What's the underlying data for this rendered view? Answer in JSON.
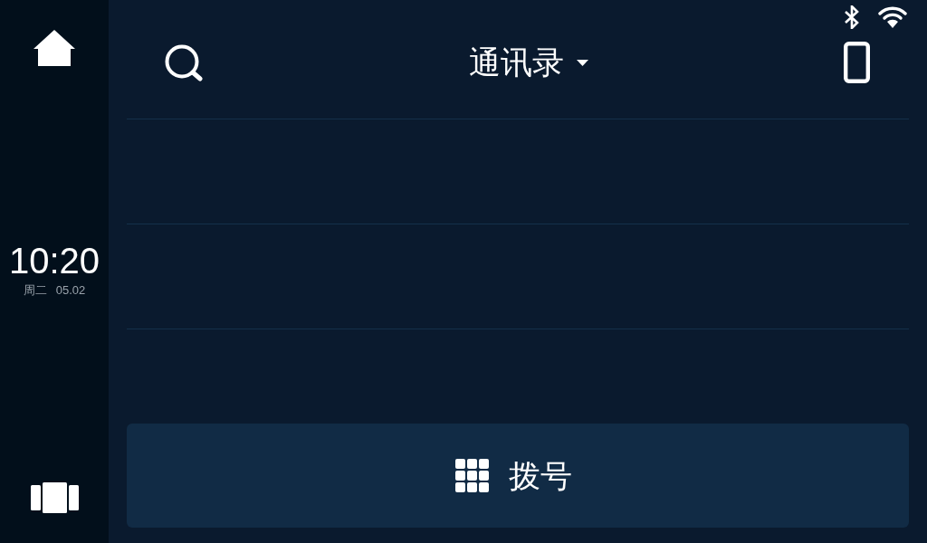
{
  "sidebar": {
    "time": "10:20",
    "weekday": "周二",
    "date": "05.02"
  },
  "header": {
    "title": "通讯录"
  },
  "dial_button": {
    "label": "拨号"
  }
}
